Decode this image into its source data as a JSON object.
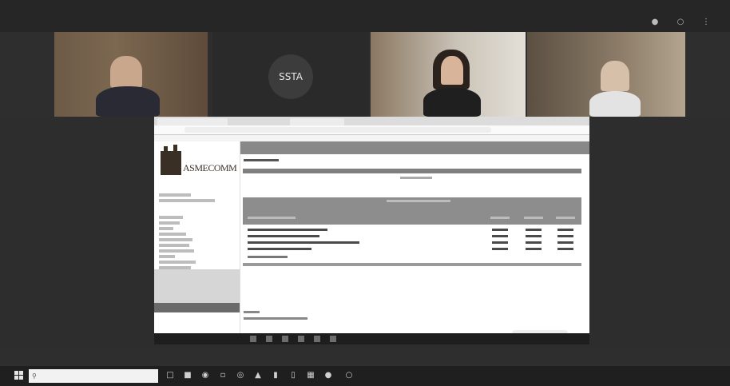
{
  "meet": {
    "title": "",
    "subtitle": "",
    "rec_label": "",
    "tiles": [
      {
        "name": "",
        "kind": "video"
      },
      {
        "name": "",
        "kind": "avatar",
        "avatar_text": "SSTA"
      },
      {
        "name": "",
        "kind": "video"
      },
      {
        "name": "",
        "kind": "video"
      }
    ]
  },
  "shared_browser": {
    "site_logo_text": "ASMECOMM",
    "status_text": "",
    "clock": ""
  },
  "taskbar": {
    "search_placeholder": "",
    "tray_time": "",
    "tray_date": ""
  },
  "icons": {
    "start": "windows-start-icon",
    "search": "search-icon",
    "chat_send": "send-icon"
  }
}
